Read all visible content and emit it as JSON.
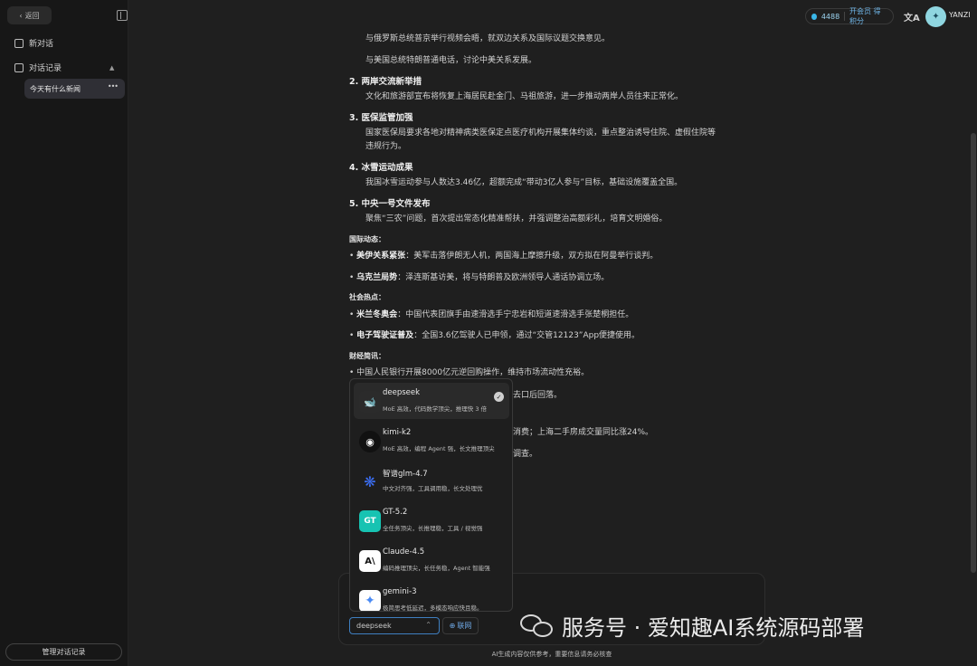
{
  "sidebar": {
    "back_label": "返回",
    "new_chat_label": "新对话",
    "history_label": "对话记录",
    "history_items": [
      "今天有什么新闻"
    ],
    "manage_label": "管理对话记录"
  },
  "topbar": {
    "credits": "4488",
    "member_label": "开会员 得积分",
    "username": "YANZI"
  },
  "content": {
    "intro_lines": [
      "与俄罗斯总统普京举行视频会晤，就双边关系及国际议题交换意见。",
      "与美国总统特朗普通电话，讨论中美关系发展。"
    ],
    "sections": [
      {
        "title": "2. 两岸交流新举措",
        "lines": [
          "文化和旅游部宣布将恢复上海居民赴金门、马祖旅游，进一步推动两岸人员往来正常化。"
        ]
      },
      {
        "title": "3. 医保监管加强",
        "lines": [
          "国家医保局要求各地对精神病类医保定点医疗机构开展集体约谈，重点整治诱导住院、虚假住院等",
          "违规行为。"
        ]
      },
      {
        "title": "4. 冰雪运动成果",
        "lines": [
          "我国冰雪运动参与人数达3.46亿，超额完成“带动3亿人参与”目标，基础设施覆盖全国。"
        ]
      },
      {
        "title": "5. 中央一号文件发布",
        "lines": [
          "聚焦“三农”问题，首次提出常态化精准帮扶，并强调整治高额彩礼，培育文明婚俗。"
        ]
      }
    ],
    "intl_title": "国际动态：",
    "intl_items": [
      {
        "bold": "美伊关系紧张",
        "text": "：美军击落伊朗无人机，两国海上摩擦升级，双方拟在阿曼举行谈判。"
      },
      {
        "bold": "乌克兰局势",
        "text": "：泽连斯基访美，将与特朗普及欧洲领导人通话协调立场。"
      }
    ],
    "social_title": "社会热点：",
    "social_items": [
      {
        "bold": "米兰冬奥会",
        "text": "：中国代表团旗手由速滑选手宁忠岩和短道速滑选手张楚桐担任。"
      },
      {
        "bold": "电子驾驶证普及",
        "text": "：全国3.6亿驾驶人已申领，通过“交管12123”App便捷使用。"
      }
    ],
    "finance_title": "财经简讯：",
    "finance_items": [
      "中国人民银行开展8000亿元逆回购操作，维持市场流动性充裕。"
    ],
    "partial_lines": [
      "去口后回落。",
      "消费；上海二手房成交量同比涨24%。",
      "调查。"
    ]
  },
  "model_menu": {
    "models": [
      {
        "name": "deepseek",
        "desc": "MoE 高效，代码数学顶尖，推理快 3 倍",
        "selected": true
      },
      {
        "name": "kimi-k2",
        "desc": "MoE 高效，编程 Agent 强，长文推理顶尖",
        "selected": false
      },
      {
        "name": "智谱glm-4.7",
        "desc": "中文对齐强，工具调用稳，长文处理优",
        "selected": false
      },
      {
        "name": "GT-5.2",
        "desc": "全任务顶尖，长推理稳，工具 / 视觉强",
        "selected": false
      },
      {
        "name": "Claude-4.5",
        "desc": "编码推理顶尖，长任务稳，Agent 智能强",
        "selected": false
      },
      {
        "name": "gemini-3",
        "desc": "极简思考低延迟，多模态响应快且稳。",
        "selected": false
      }
    ]
  },
  "input": {
    "selected_model": "deepseek",
    "web_label": "联网"
  },
  "disclaimer": "AI生成内容仅供参考，重要信息请务必核查",
  "watermark": "服务号 · 爱知趣AI系统源码部署",
  "colors": {
    "accent": "#3f7fc0",
    "link": "#6fa9e6",
    "credit_dot": "#3ab7e8"
  }
}
